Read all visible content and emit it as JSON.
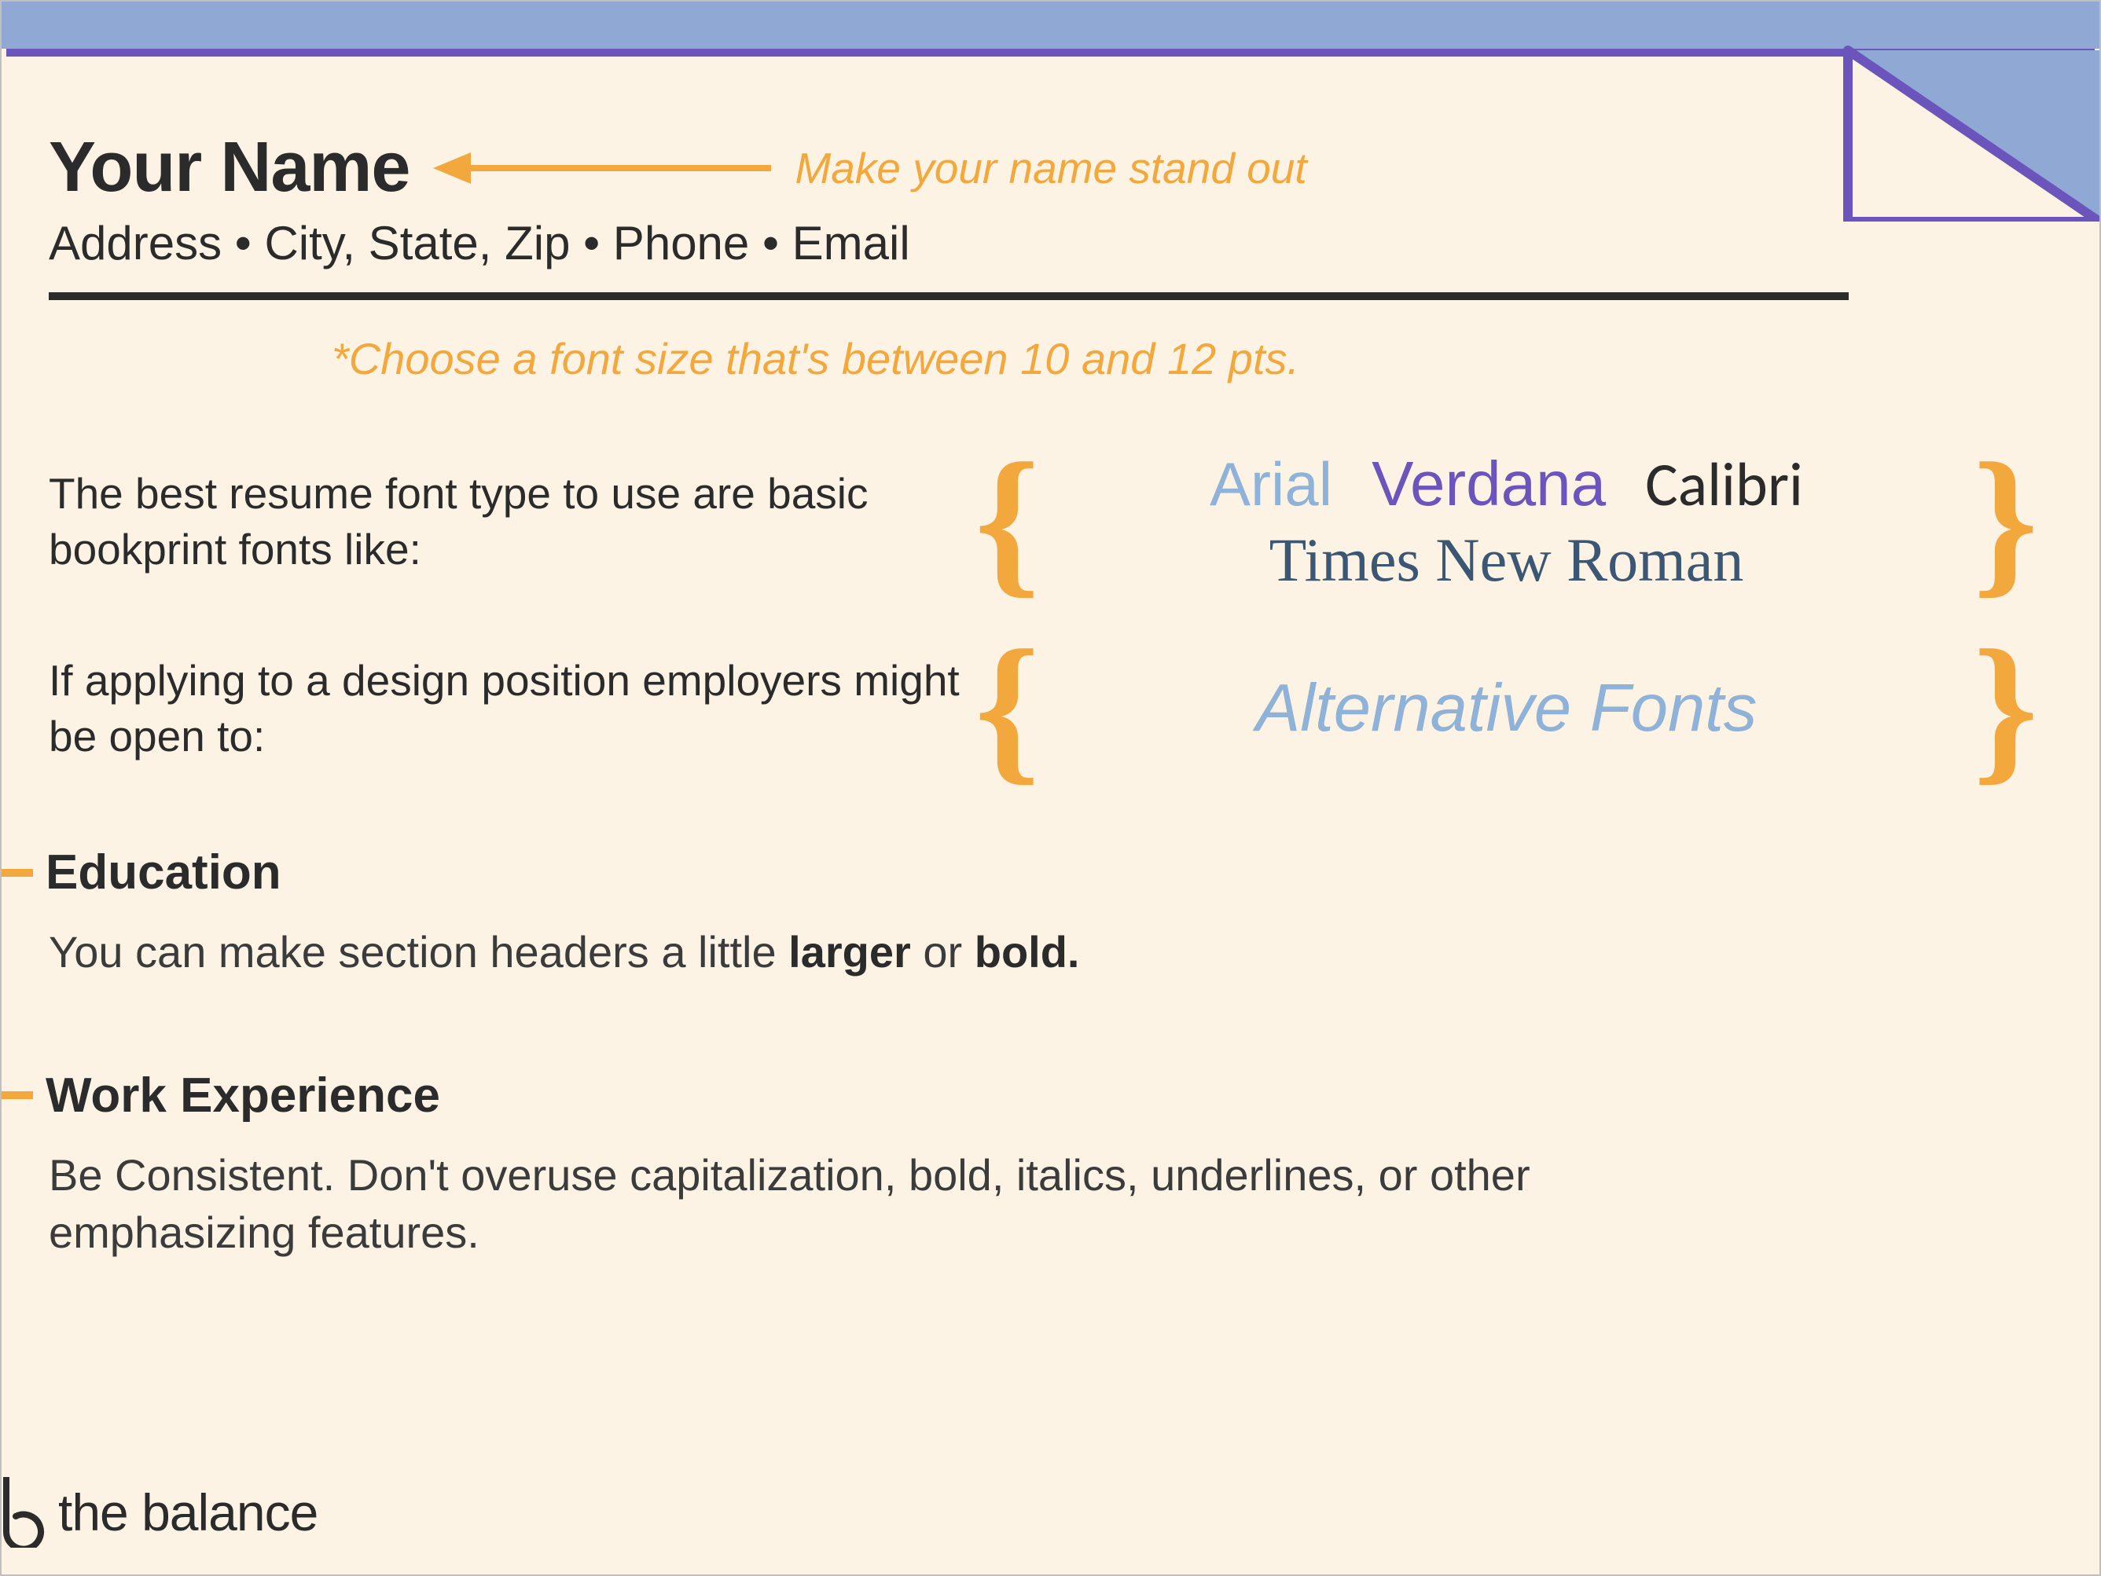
{
  "header": {
    "name": "Your Name",
    "name_tip": "Make your name stand out",
    "contact": "Address • City, State, Zip • Phone • Email",
    "font_size_tip": "*Choose a font size that's between 10 and 12 pts."
  },
  "tips": {
    "basic_fonts_text": "The best resume font type to use are basic bookprint fonts like:",
    "basic_fonts": {
      "arial": "Arial",
      "verdana": "Verdana",
      "calibri": "Calibri",
      "times": "Times New Roman"
    },
    "design_text": "If applying to a design position employers might be open to:",
    "alt_fonts_label": "Alternative Fonts"
  },
  "sections": {
    "education": {
      "title": "Education",
      "body_pre": "You can make section headers a little ",
      "body_b1": "larger",
      "body_mid": " or ",
      "body_b2": "bold."
    },
    "work": {
      "title": "Work Experience",
      "body": "Be Consistent. Don't overuse capitalization, bold, italics, underlines, or other emphasizing features."
    }
  },
  "brand": "the balance",
  "colors": {
    "accent": "#f2a83c",
    "purple": "#6b55bd",
    "blue": "#90a9d4"
  }
}
